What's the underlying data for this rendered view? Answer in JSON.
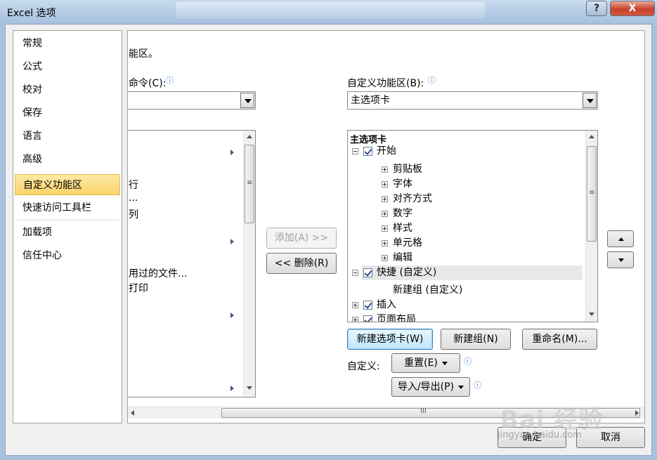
{
  "window": {
    "title": "Excel 选项",
    "help_label": "?",
    "close_label": "X"
  },
  "nav": {
    "items": [
      {
        "label": "常规"
      },
      {
        "label": "公式"
      },
      {
        "label": "校对"
      },
      {
        "label": "保存"
      },
      {
        "label": "语言"
      },
      {
        "label": "高级"
      },
      {
        "label": "自定义功能区",
        "selected": true
      },
      {
        "label": "快速访问工具栏"
      },
      {
        "label": "加载项"
      },
      {
        "label": "信任中心"
      }
    ]
  },
  "content": {
    "heading_fragment": "能区。",
    "left_label": "命令(C):",
    "left_label_underline": "C",
    "left_combo_value": "",
    "left_list_fragments": [
      "行",
      "...",
      "列",
      "用过的文件...",
      "打印"
    ],
    "right_label": "自定义功能区(B):",
    "right_combo_value": "主选项卡",
    "add_button": "添加(A) >>",
    "remove_button": "<< 删除(R)",
    "tree": {
      "header": "主选项卡",
      "items": [
        {
          "label": "开始",
          "level": 0,
          "checked": true,
          "expanded": true
        },
        {
          "label": "剪贴板",
          "level": 1
        },
        {
          "label": "字体",
          "level": 1
        },
        {
          "label": "对齐方式",
          "level": 1
        },
        {
          "label": "数字",
          "level": 1
        },
        {
          "label": "样式",
          "level": 1
        },
        {
          "label": "单元格",
          "level": 1
        },
        {
          "label": "编辑",
          "level": 1
        },
        {
          "label": "快捷 (自定义)",
          "level": 0,
          "checked": true,
          "expanded": true,
          "selected": true
        },
        {
          "label": "新建组 (自定义)",
          "level": 1
        },
        {
          "label": "插入",
          "level": 0,
          "checked": true
        },
        {
          "label": "页面布局",
          "level": 0,
          "checked": true
        }
      ]
    },
    "new_tab_button": "新建选项卡(W)",
    "new_group_button": "新建组(N)",
    "rename_button": "重命名(M)...",
    "customize_label": "自定义:",
    "reset_button": "重置(E)",
    "import_export_button": "导入/导出(P)",
    "hscroll_grip": "III"
  },
  "footer": {
    "ok_button": "确定",
    "cancel_button": "取消"
  },
  "watermark": {
    "text": "Bai 经验",
    "sub": "jingyan.baidu.com"
  },
  "colors": {
    "selection": "#fbd46a",
    "focus_border": "#3c7fb1"
  }
}
